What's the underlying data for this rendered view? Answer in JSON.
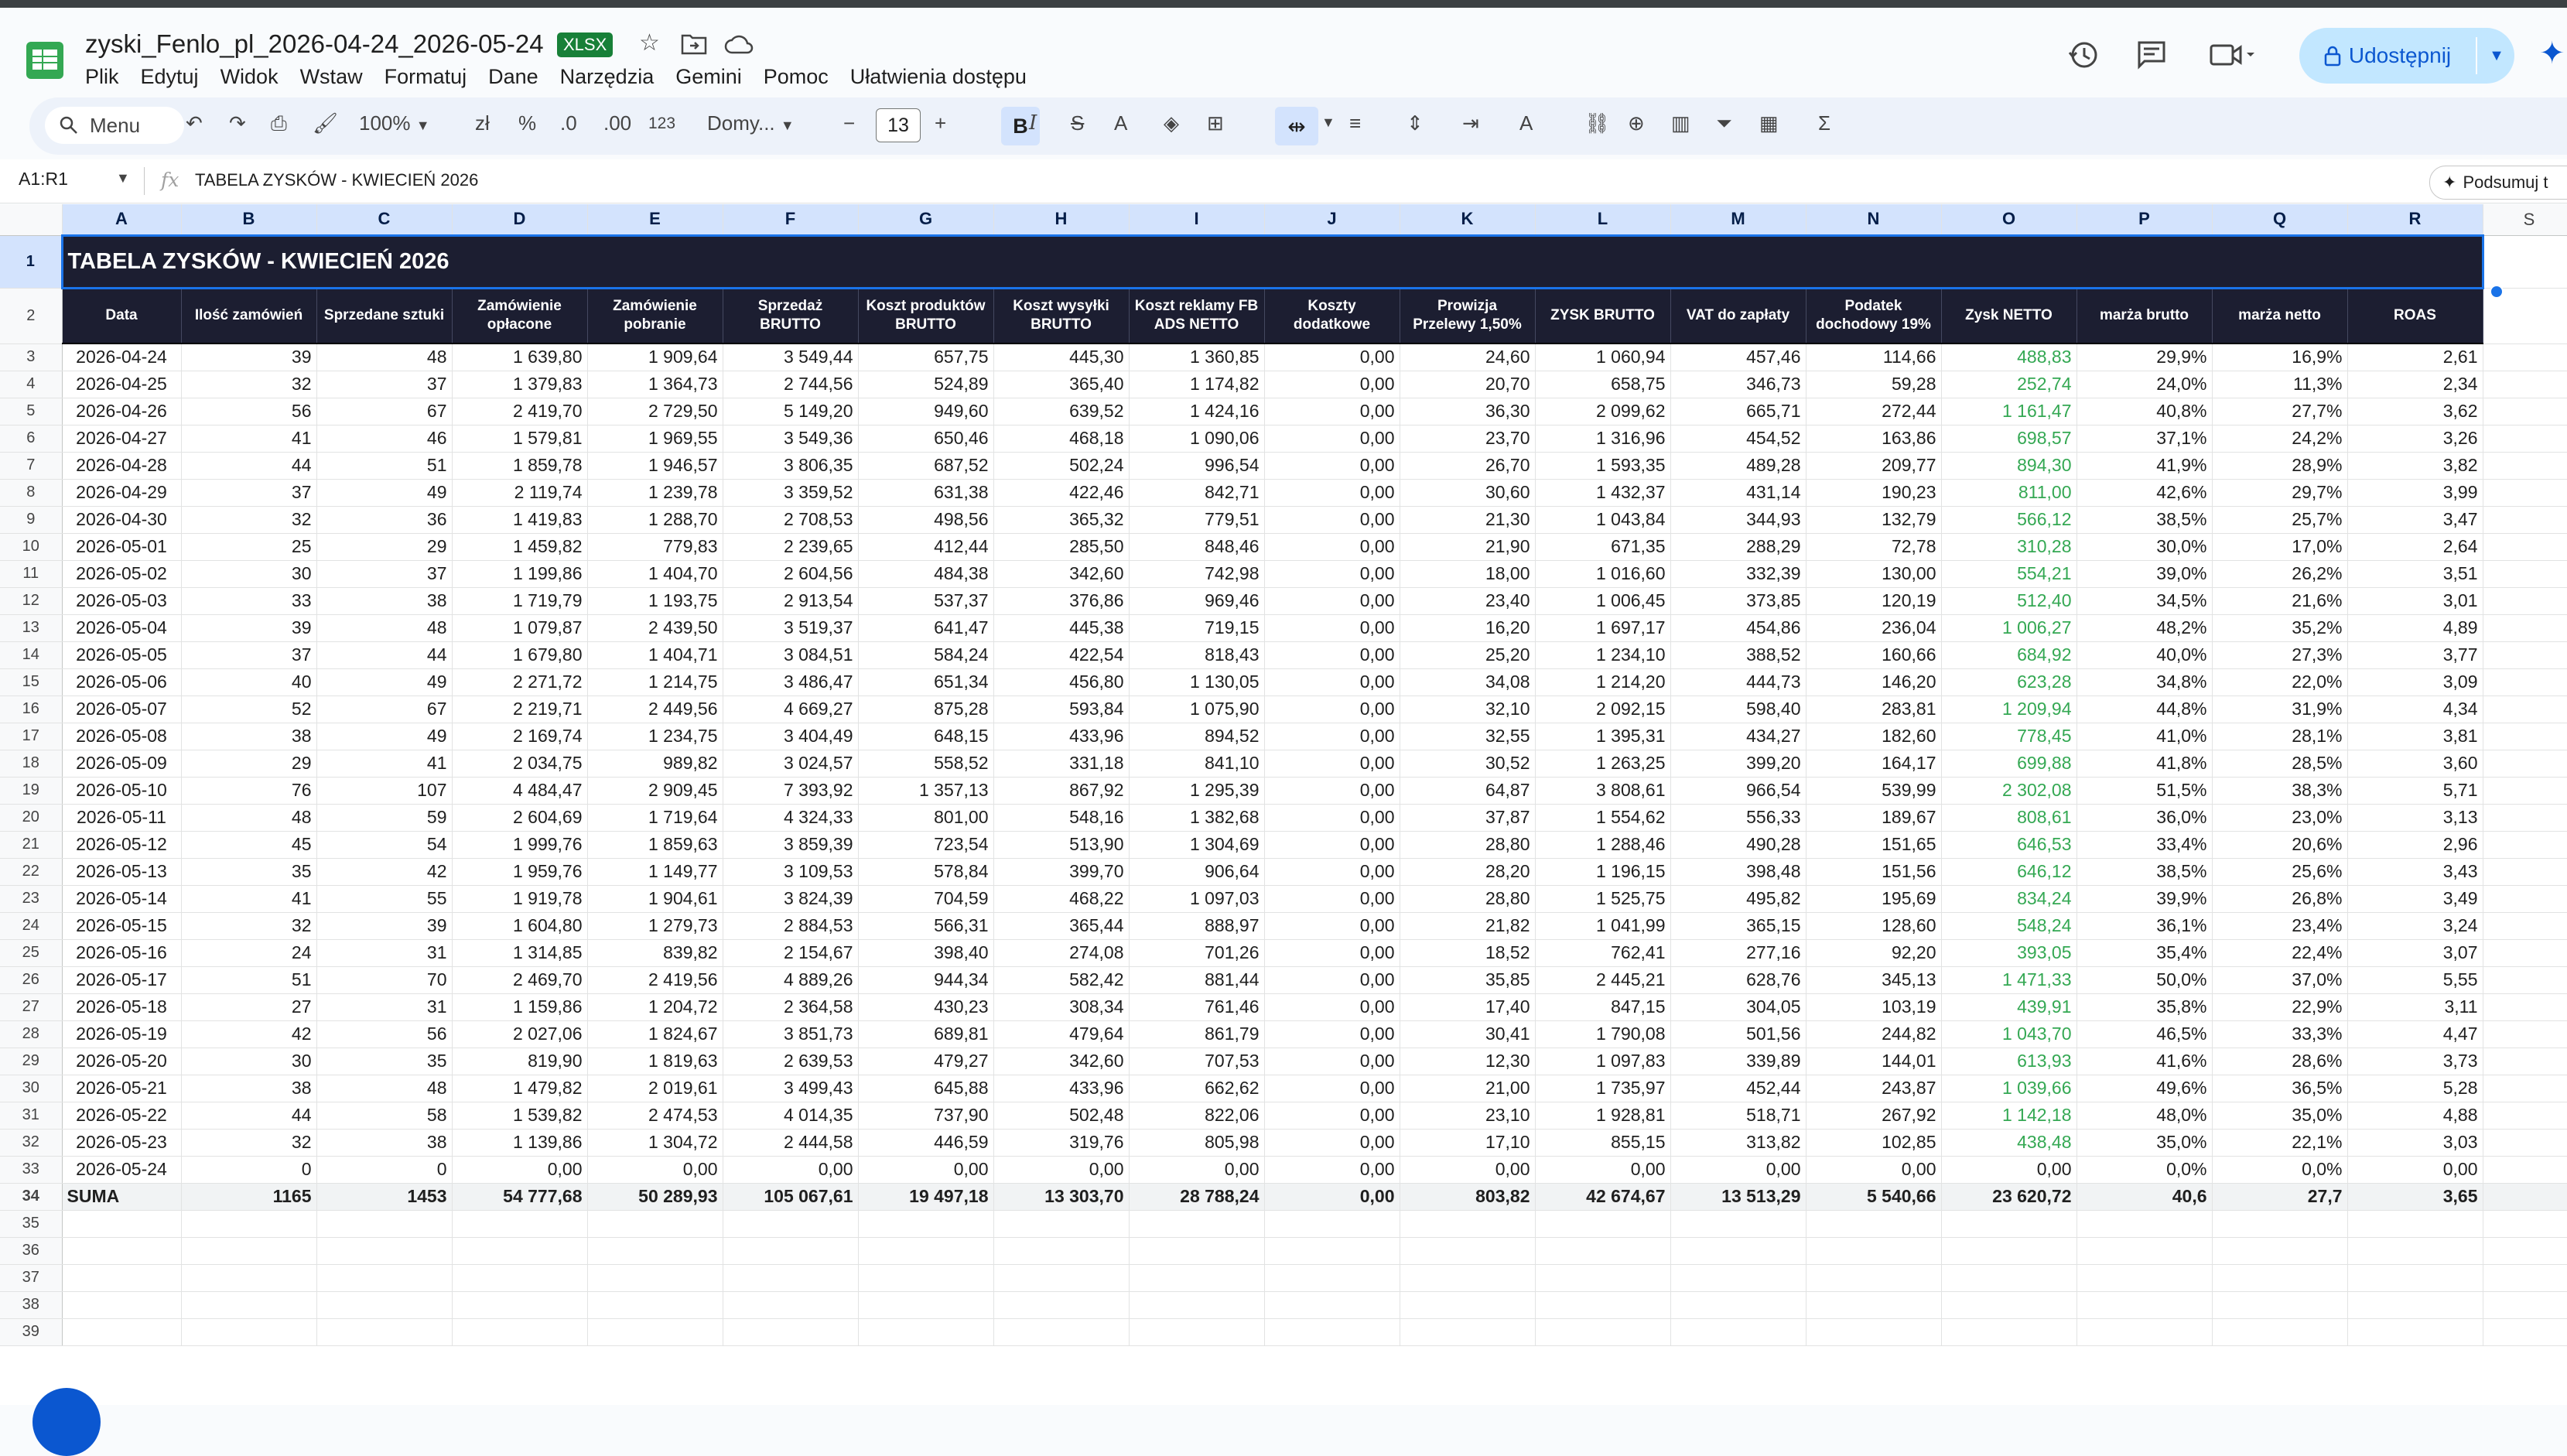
{
  "doc": {
    "title": "zyski_Fenlo_pl_2026-04-24_2026-05-24",
    "badge": "XLSX",
    "menus": [
      "Plik",
      "Edytuj",
      "Widok",
      "Wstaw",
      "Formatuj",
      "Dane",
      "Narzędzia",
      "Gemini",
      "Pomoc",
      "Ułatwienia dostępu"
    ],
    "share_label": "Udostępnij"
  },
  "toolbar": {
    "search_label": "Menu",
    "zoom": "100%",
    "currency": "zł",
    "percent": "%",
    "dec_decrease": ".0",
    "dec_increase": ".00",
    "number_format": "123",
    "font": "Domy...",
    "font_size": "13"
  },
  "formula_bar": {
    "name_box": "A1:R1",
    "fx": "fx",
    "value": "TABELA ZYSKÓW - KWIECIEŃ 2026",
    "summarize": "Podsumuj t"
  },
  "sheet": {
    "columns": [
      "A",
      "B",
      "C",
      "D",
      "E",
      "F",
      "G",
      "H",
      "I",
      "J",
      "K",
      "L",
      "M",
      "N",
      "O",
      "P",
      "Q",
      "R",
      "S"
    ],
    "title": "TABELA ZYSKÓW - KWIECIEŃ 2026",
    "headers": [
      "Data",
      "Ilość zamówień",
      "Sprzedane sztuki",
      "Zamówienie opłacone",
      "Zamówienie pobranie",
      "Sprzedaż BRUTTO",
      "Koszt produktów BRUTTO",
      "Koszt wysyłki BRUTTO",
      "Koszt reklamy FB ADS NETTO",
      "Koszty dodatkowe",
      "Prowizja Przelewy 1,50%",
      "ZYSK BRUTTO",
      "VAT do zapłaty",
      "Podatek dochodowy 19%",
      "Zysk NETTO",
      "marża brutto",
      "marża netto",
      "ROAS"
    ],
    "rows": [
      [
        "2026-04-24",
        "39",
        "48",
        "1 639,80",
        "1 909,64",
        "3 549,44",
        "657,75",
        "445,30",
        "1 360,85",
        "0,00",
        "24,60",
        "1 060,94",
        "457,46",
        "114,66",
        "488,83",
        "29,9%",
        "16,9%",
        "2,61"
      ],
      [
        "2026-04-25",
        "32",
        "37",
        "1 379,83",
        "1 364,73",
        "2 744,56",
        "524,89",
        "365,40",
        "1 174,82",
        "0,00",
        "20,70",
        "658,75",
        "346,73",
        "59,28",
        "252,74",
        "24,0%",
        "11,3%",
        "2,34"
      ],
      [
        "2026-04-26",
        "56",
        "67",
        "2 419,70",
        "2 729,50",
        "5 149,20",
        "949,60",
        "639,52",
        "1 424,16",
        "0,00",
        "36,30",
        "2 099,62",
        "665,71",
        "272,44",
        "1 161,47",
        "40,8%",
        "27,7%",
        "3,62"
      ],
      [
        "2026-04-27",
        "41",
        "46",
        "1 579,81",
        "1 969,55",
        "3 549,36",
        "650,46",
        "468,18",
        "1 090,06",
        "0,00",
        "23,70",
        "1 316,96",
        "454,52",
        "163,86",
        "698,57",
        "37,1%",
        "24,2%",
        "3,26"
      ],
      [
        "2026-04-28",
        "44",
        "51",
        "1 859,78",
        "1 946,57",
        "3 806,35",
        "687,52",
        "502,24",
        "996,54",
        "0,00",
        "26,70",
        "1 593,35",
        "489,28",
        "209,77",
        "894,30",
        "41,9%",
        "28,9%",
        "3,82"
      ],
      [
        "2026-04-29",
        "37",
        "49",
        "2 119,74",
        "1 239,78",
        "3 359,52",
        "631,38",
        "422,46",
        "842,71",
        "0,00",
        "30,60",
        "1 432,37",
        "431,14",
        "190,23",
        "811,00",
        "42,6%",
        "29,7%",
        "3,99"
      ],
      [
        "2026-04-30",
        "32",
        "36",
        "1 419,83",
        "1 288,70",
        "2 708,53",
        "498,56",
        "365,32",
        "779,51",
        "0,00",
        "21,30",
        "1 043,84",
        "344,93",
        "132,79",
        "566,12",
        "38,5%",
        "25,7%",
        "3,47"
      ],
      [
        "2026-05-01",
        "25",
        "29",
        "1 459,82",
        "779,83",
        "2 239,65",
        "412,44",
        "285,50",
        "848,46",
        "0,00",
        "21,90",
        "671,35",
        "288,29",
        "72,78",
        "310,28",
        "30,0%",
        "17,0%",
        "2,64"
      ],
      [
        "2026-05-02",
        "30",
        "37",
        "1 199,86",
        "1 404,70",
        "2 604,56",
        "484,38",
        "342,60",
        "742,98",
        "0,00",
        "18,00",
        "1 016,60",
        "332,39",
        "130,00",
        "554,21",
        "39,0%",
        "26,2%",
        "3,51"
      ],
      [
        "2026-05-03",
        "33",
        "38",
        "1 719,79",
        "1 193,75",
        "2 913,54",
        "537,37",
        "376,86",
        "969,46",
        "0,00",
        "23,40",
        "1 006,45",
        "373,85",
        "120,19",
        "512,40",
        "34,5%",
        "21,6%",
        "3,01"
      ],
      [
        "2026-05-04",
        "39",
        "48",
        "1 079,87",
        "2 439,50",
        "3 519,37",
        "641,47",
        "445,38",
        "719,15",
        "0,00",
        "16,20",
        "1 697,17",
        "454,86",
        "236,04",
        "1 006,27",
        "48,2%",
        "35,2%",
        "4,89"
      ],
      [
        "2026-05-05",
        "37",
        "44",
        "1 679,80",
        "1 404,71",
        "3 084,51",
        "584,24",
        "422,54",
        "818,43",
        "0,00",
        "25,20",
        "1 234,10",
        "388,52",
        "160,66",
        "684,92",
        "40,0%",
        "27,3%",
        "3,77"
      ],
      [
        "2026-05-06",
        "40",
        "49",
        "2 271,72",
        "1 214,75",
        "3 486,47",
        "651,34",
        "456,80",
        "1 130,05",
        "0,00",
        "34,08",
        "1 214,20",
        "444,73",
        "146,20",
        "623,28",
        "34,8%",
        "22,0%",
        "3,09"
      ],
      [
        "2026-05-07",
        "52",
        "67",
        "2 219,71",
        "2 449,56",
        "4 669,27",
        "875,28",
        "593,84",
        "1 075,90",
        "0,00",
        "32,10",
        "2 092,15",
        "598,40",
        "283,81",
        "1 209,94",
        "44,8%",
        "31,9%",
        "4,34"
      ],
      [
        "2026-05-08",
        "38",
        "49",
        "2 169,74",
        "1 234,75",
        "3 404,49",
        "648,15",
        "433,96",
        "894,52",
        "0,00",
        "32,55",
        "1 395,31",
        "434,27",
        "182,60",
        "778,45",
        "41,0%",
        "28,1%",
        "3,81"
      ],
      [
        "2026-05-09",
        "29",
        "41",
        "2 034,75",
        "989,82",
        "3 024,57",
        "558,52",
        "331,18",
        "841,10",
        "0,00",
        "30,52",
        "1 263,25",
        "399,20",
        "164,17",
        "699,88",
        "41,8%",
        "28,5%",
        "3,60"
      ],
      [
        "2026-05-10",
        "76",
        "107",
        "4 484,47",
        "2 909,45",
        "7 393,92",
        "1 357,13",
        "867,92",
        "1 295,39",
        "0,00",
        "64,87",
        "3 808,61",
        "966,54",
        "539,99",
        "2 302,08",
        "51,5%",
        "38,3%",
        "5,71"
      ],
      [
        "2026-05-11",
        "48",
        "59",
        "2 604,69",
        "1 719,64",
        "4 324,33",
        "801,00",
        "548,16",
        "1 382,68",
        "0,00",
        "37,87",
        "1 554,62",
        "556,33",
        "189,67",
        "808,61",
        "36,0%",
        "23,0%",
        "3,13"
      ],
      [
        "2026-05-12",
        "45",
        "54",
        "1 999,76",
        "1 859,63",
        "3 859,39",
        "723,54",
        "513,90",
        "1 304,69",
        "0,00",
        "28,80",
        "1 288,46",
        "490,28",
        "151,65",
        "646,53",
        "33,4%",
        "20,6%",
        "2,96"
      ],
      [
        "2026-05-13",
        "35",
        "42",
        "1 959,76",
        "1 149,77",
        "3 109,53",
        "578,84",
        "399,70",
        "906,64",
        "0,00",
        "28,20",
        "1 196,15",
        "398,48",
        "151,56",
        "646,12",
        "38,5%",
        "25,6%",
        "3,43"
      ],
      [
        "2026-05-14",
        "41",
        "55",
        "1 919,78",
        "1 904,61",
        "3 824,39",
        "704,59",
        "468,22",
        "1 097,03",
        "0,00",
        "28,80",
        "1 525,75",
        "495,82",
        "195,69",
        "834,24",
        "39,9%",
        "26,8%",
        "3,49"
      ],
      [
        "2026-05-15",
        "32",
        "39",
        "1 604,80",
        "1 279,73",
        "2 884,53",
        "566,31",
        "365,44",
        "888,97",
        "0,00",
        "21,82",
        "1 041,99",
        "365,15",
        "128,60",
        "548,24",
        "36,1%",
        "23,4%",
        "3,24"
      ],
      [
        "2026-05-16",
        "24",
        "31",
        "1 314,85",
        "839,82",
        "2 154,67",
        "398,40",
        "274,08",
        "701,26",
        "0,00",
        "18,52",
        "762,41",
        "277,16",
        "92,20",
        "393,05",
        "35,4%",
        "22,4%",
        "3,07"
      ],
      [
        "2026-05-17",
        "51",
        "70",
        "2 469,70",
        "2 419,56",
        "4 889,26",
        "944,34",
        "582,42",
        "881,44",
        "0,00",
        "35,85",
        "2 445,21",
        "628,76",
        "345,13",
        "1 471,33",
        "50,0%",
        "37,0%",
        "5,55"
      ],
      [
        "2026-05-18",
        "27",
        "31",
        "1 159,86",
        "1 204,72",
        "2 364,58",
        "430,23",
        "308,34",
        "761,46",
        "0,00",
        "17,40",
        "847,15",
        "304,05",
        "103,19",
        "439,91",
        "35,8%",
        "22,9%",
        "3,11"
      ],
      [
        "2026-05-19",
        "42",
        "56",
        "2 027,06",
        "1 824,67",
        "3 851,73",
        "689,81",
        "479,64",
        "861,79",
        "0,00",
        "30,41",
        "1 790,08",
        "501,56",
        "244,82",
        "1 043,70",
        "46,5%",
        "33,3%",
        "4,47"
      ],
      [
        "2026-05-20",
        "30",
        "35",
        "819,90",
        "1 819,63",
        "2 639,53",
        "479,27",
        "342,60",
        "707,53",
        "0,00",
        "12,30",
        "1 097,83",
        "339,89",
        "144,01",
        "613,93",
        "41,6%",
        "28,6%",
        "3,73"
      ],
      [
        "2026-05-21",
        "38",
        "48",
        "1 479,82",
        "2 019,61",
        "3 499,43",
        "645,88",
        "433,96",
        "662,62",
        "0,00",
        "21,00",
        "1 735,97",
        "452,44",
        "243,87",
        "1 039,66",
        "49,6%",
        "36,5%",
        "5,28"
      ],
      [
        "2026-05-22",
        "44",
        "58",
        "1 539,82",
        "2 474,53",
        "4 014,35",
        "737,90",
        "502,48",
        "822,06",
        "0,00",
        "23,10",
        "1 928,81",
        "518,71",
        "267,92",
        "1 142,18",
        "48,0%",
        "35,0%",
        "4,88"
      ],
      [
        "2026-05-23",
        "32",
        "38",
        "1 139,86",
        "1 304,72",
        "2 444,58",
        "446,59",
        "319,76",
        "805,98",
        "0,00",
        "17,10",
        "855,15",
        "313,82",
        "102,85",
        "438,48",
        "35,0%",
        "22,1%",
        "3,03"
      ],
      [
        "2026-05-24",
        "0",
        "0",
        "0,00",
        "0,00",
        "0,00",
        "0,00",
        "0,00",
        "0,00",
        "0,00",
        "0,00",
        "0,00",
        "0,00",
        "0,00",
        "0,00",
        "0,0%",
        "0,0%",
        "0,00"
      ]
    ],
    "sum": [
      "SUMA",
      "1165",
      "1453",
      "54 777,68",
      "50 289,93",
      "105 067,61",
      "19 497,18",
      "13 303,70",
      "28 788,24",
      "0,00",
      "803,82",
      "42 674,67",
      "13 513,29",
      "5 540,66",
      "23 620,72",
      "40,6",
      "27,7",
      "3,65"
    ],
    "row_numbers": [
      "1",
      "2",
      "3",
      "4",
      "5",
      "6",
      "7",
      "8",
      "9",
      "10",
      "11",
      "12",
      "13",
      "14",
      "15",
      "16",
      "17",
      "18",
      "19",
      "20",
      "21",
      "22",
      "23",
      "24",
      "25",
      "26",
      "27",
      "28",
      "29",
      "30",
      "31",
      "32",
      "33",
      "34",
      "35",
      "36",
      "37",
      "38",
      "39"
    ]
  },
  "colors": {
    "header_bg": "#1c1e31",
    "profit_green": "#34a853",
    "selection_blue": "#1a73e8",
    "share_bg": "#c2e7ff"
  },
  "icons": [
    "sheets-logo-icon",
    "star-icon",
    "move-folder-icon",
    "cloud-status-icon",
    "history-icon",
    "comments-icon",
    "meet-icon",
    "lock-icon",
    "gemini-icon",
    "search-icon",
    "undo-icon",
    "redo-icon",
    "print-icon",
    "paint-format-icon",
    "bold-icon",
    "italic-icon",
    "strikethrough-icon",
    "text-color-icon",
    "fill-color-icon",
    "borders-icon",
    "merge-icon",
    "align-icon",
    "valign-icon",
    "wrap-icon",
    "rotate-icon",
    "link-icon",
    "comment-add-icon",
    "chart-icon",
    "filter-icon",
    "table-icon",
    "sum-icon"
  ]
}
